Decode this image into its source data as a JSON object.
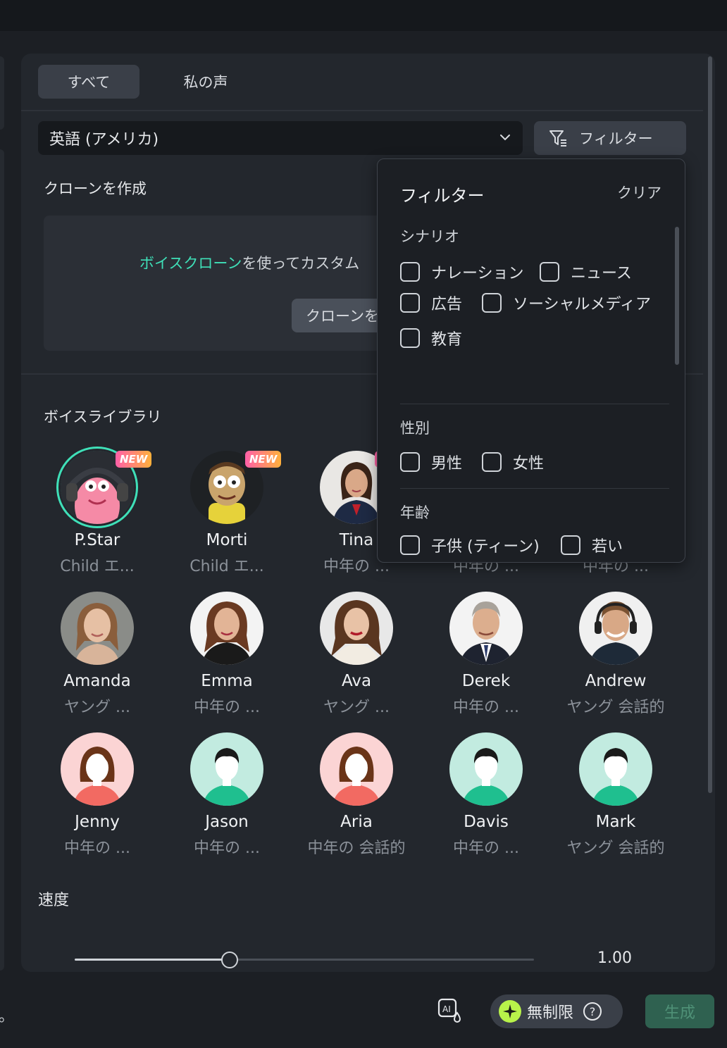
{
  "tabs": [
    {
      "label": "すべて"
    },
    {
      "label": "私の声"
    }
  ],
  "language": {
    "selected": "英語 (アメリカ)"
  },
  "filter_button": {
    "label": "フィルター"
  },
  "clone": {
    "title": "クローンを作成",
    "text_link": "ボイスクローン",
    "text_rest": "を使ってカスタム",
    "button_label": "クローンを"
  },
  "library": {
    "title": "ボイスライブラリ",
    "new_badge": "NEW",
    "voices": [
      {
        "name": "P.Star",
        "desc": "Child エ...",
        "is_new": true,
        "selected": true
      },
      {
        "name": "Morti",
        "desc": "Child エ...",
        "is_new": true
      },
      {
        "name": "Tina",
        "desc": "中年の ...",
        "is_new": true
      },
      {
        "name": "",
        "desc": "中年の ..."
      },
      {
        "name": "",
        "desc": "中年の ..."
      },
      {
        "name": "Amanda",
        "desc": "ヤング ..."
      },
      {
        "name": "Emma",
        "desc": "中年の ..."
      },
      {
        "name": "Ava",
        "desc": "ヤング ..."
      },
      {
        "name": "Derek",
        "desc": "中年の ..."
      },
      {
        "name": "Andrew",
        "desc": "ヤング 会話的"
      },
      {
        "name": "Jenny",
        "desc": "中年の ..."
      },
      {
        "name": "Jason",
        "desc": "中年の ..."
      },
      {
        "name": "Aria",
        "desc": "中年の 会話的"
      },
      {
        "name": "Davis",
        "desc": "中年の ..."
      },
      {
        "name": "Mark",
        "desc": "ヤング 会話的"
      }
    ]
  },
  "speed": {
    "label": "速度",
    "value": "1.00",
    "fraction": 0.337
  },
  "filter_popup": {
    "title": "フィルター",
    "clear": "クリア",
    "sections": [
      {
        "title": "シナリオ",
        "options": [
          "ナレーション",
          "ニュース",
          "広告",
          "ソーシャルメディア",
          "教育"
        ]
      },
      {
        "title": "性別",
        "options": [
          "男性",
          "女性"
        ]
      },
      {
        "title": "年齢",
        "options": [
          "子供 (ティーン)",
          "若い"
        ]
      }
    ]
  },
  "bottom": {
    "left_text": "。",
    "unlimited_label": "無制限",
    "generate_label": "生成"
  },
  "colors": {
    "accent": "#3fe0b8",
    "panel": "#23272d",
    "background": "#1c1f24",
    "spark": "#b8f24a",
    "generate": "#2f6150"
  },
  "icons": [
    "chevron-down-icon",
    "filter-icon",
    "ai-voice-icon",
    "spark-icon",
    "help-icon"
  ]
}
